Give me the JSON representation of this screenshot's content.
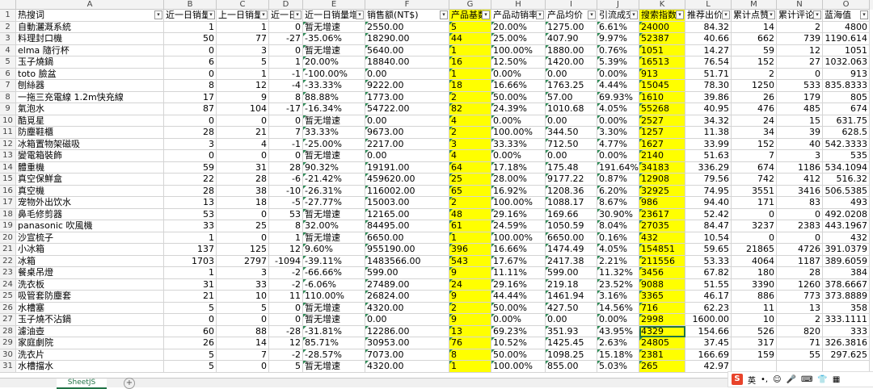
{
  "columns": [
    "A",
    "B",
    "C",
    "D",
    "E",
    "F",
    "G",
    "H",
    "I",
    "J",
    "K",
    "L",
    "M",
    "N",
    "O"
  ],
  "headers": [
    "热搜词",
    "近一日销量",
    "上一日销量",
    "近一日",
    "近一日销量增",
    "销售额(NT$)",
    "产品基数",
    "产品动销率",
    "产品均价",
    "引流成交",
    "搜索指数",
    "推荐出价",
    "累计点赞",
    "累计评论",
    "蓝海值"
  ],
  "rows": [
    [
      "自動灑溉系統",
      "1",
      "1",
      "0",
      "暂无增速",
      "2550.00",
      "5",
      "20.00%",
      "1275.00",
      "6.61%",
      "24000",
      "84.32",
      "14",
      "2",
      "4800"
    ],
    [
      "料理封口機",
      "50",
      "77",
      "-27",
      "-35.06%",
      "18290.00",
      "44",
      "25.00%",
      "407.90",
      "9.97%",
      "52387",
      "40.66",
      "662",
      "739",
      "1190.614"
    ],
    [
      "elma 隨行杯",
      "0",
      "3",
      "0",
      "暂无增速",
      "5640.00",
      "1",
      "100.00%",
      "1880.00",
      "0.76%",
      "1051",
      "14.27",
      "59",
      "12",
      "1051"
    ],
    [
      "玉子燒鍋",
      "6",
      "5",
      "1",
      "20.00%",
      "18840.00",
      "16",
      "12.50%",
      "1420.00",
      "5.39%",
      "16513",
      "76.54",
      "152",
      "27",
      "1032.063"
    ],
    [
      "toto 臉盆",
      "0",
      "1",
      "-1",
      "-100.00%",
      "0.00",
      "1",
      "0.00%",
      "0.00",
      "0.00%",
      "913",
      "51.71",
      "2",
      "0",
      "913"
    ],
    [
      "刨絲器",
      "8",
      "12",
      "-4",
      "-33.33%",
      "9222.00",
      "18",
      "16.66%",
      "1763.25",
      "4.44%",
      "15045",
      "78.30",
      "1250",
      "533",
      "835.8333"
    ],
    [
      "一拖三充電線 1.2m快充線",
      "17",
      "9",
      "8",
      "88.88%",
      "1773.00",
      "2",
      "50.00%",
      "57.00",
      "69.93%",
      "1610",
      "39.86",
      "26",
      "179",
      "805"
    ],
    [
      "氣泡水",
      "87",
      "104",
      "-17",
      "-16.34%",
      "54722.00",
      "82",
      "24.39%",
      "1010.68",
      "4.05%",
      "55268",
      "40.95",
      "476",
      "485",
      "674"
    ],
    [
      "酷覓星",
      "0",
      "0",
      "0",
      "暂无增速",
      "0.00",
      "4",
      "0.00%",
      "0.00",
      "0.00%",
      "2527",
      "34.32",
      "24",
      "15",
      "631.75"
    ],
    [
      "防塵鞋櫃",
      "28",
      "21",
      "7",
      "33.33%",
      "9673.00",
      "2",
      "100.00%",
      "344.50",
      "3.30%",
      "1257",
      "11.38",
      "34",
      "39",
      "628.5"
    ],
    [
      "冰箱置物架磁吸",
      "3",
      "4",
      "-1",
      "-25.00%",
      "2217.00",
      "3",
      "33.33%",
      "712.50",
      "4.77%",
      "1627",
      "33.99",
      "152",
      "40",
      "542.3333"
    ],
    [
      "變電箱裝飾",
      "0",
      "0",
      "0",
      "暂无增速",
      "0.00",
      "4",
      "0.00%",
      "0.00",
      "0.00%",
      "2140",
      "51.63",
      "7",
      "3",
      "535"
    ],
    [
      "體重機",
      "59",
      "31",
      "28",
      "90.32%",
      "19191.00",
      "64",
      "17.18%",
      "175.48",
      "191.64%",
      "34183",
      "336.29",
      "674",
      "1186",
      "534.1094"
    ],
    [
      "真空保鮮盒",
      "22",
      "28",
      "-6",
      "-21.42%",
      "459620.00",
      "25",
      "28.00%",
      "9177.22",
      "0.87%",
      "12908",
      "79.56",
      "742",
      "412",
      "516.32"
    ],
    [
      "真空機",
      "28",
      "38",
      "-10",
      "-26.31%",
      "116002.00",
      "65",
      "16.92%",
      "1208.36",
      "6.20%",
      "32925",
      "74.95",
      "3551",
      "3416",
      "506.5385"
    ],
    [
      "宠物外出饮水",
      "13",
      "18",
      "-5",
      "-27.77%",
      "15003.00",
      "2",
      "100.00%",
      "1088.17",
      "8.67%",
      "986",
      "94.40",
      "171",
      "83",
      "493"
    ],
    [
      "鼻毛修剪器",
      "53",
      "0",
      "53",
      "暂无增速",
      "12165.00",
      "48",
      "29.16%",
      "169.66",
      "30.90%",
      "23617",
      "52.42",
      "0",
      "0",
      "492.0208"
    ],
    [
      "panasonic 吹風機",
      "33",
      "25",
      "8",
      "32.00%",
      "84495.00",
      "61",
      "24.59%",
      "1050.59",
      "8.04%",
      "27035",
      "84.47",
      "3237",
      "2383",
      "443.1967"
    ],
    [
      "沙宣梳子",
      "1",
      "0",
      "1",
      "暂无增速",
      "6650.00",
      "1",
      "100.00%",
      "6650.00",
      "0.16%",
      "432",
      "10.54",
      "0",
      "0",
      "432"
    ],
    [
      "小冰箱",
      "137",
      "125",
      "12",
      "9.60%",
      "955190.00",
      "396",
      "16.66%",
      "1474.49",
      "4.05%",
      "154851",
      "59.65",
      "21865",
      "4726",
      "391.0379"
    ],
    [
      "冰箱",
      "1703",
      "2797",
      "-1094",
      "-39.11%",
      "1483566.00",
      "543",
      "17.67%",
      "2417.38",
      "2.21%",
      "211556",
      "53.33",
      "4064",
      "1187",
      "389.6059"
    ],
    [
      "餐桌吊燈",
      "1",
      "3",
      "-2",
      "-66.66%",
      "599.00",
      "9",
      "11.11%",
      "599.00",
      "11.32%",
      "3456",
      "67.82",
      "180",
      "28",
      "384"
    ],
    [
      "洗衣板",
      "31",
      "33",
      "-2",
      "-6.06%",
      "27489.00",
      "24",
      "29.16%",
      "219.18",
      "23.52%",
      "9088",
      "51.55",
      "3390",
      "1260",
      "378.6667"
    ],
    [
      "吸管套防塵套",
      "21",
      "10",
      "11",
      "110.00%",
      "26824.00",
      "9",
      "44.44%",
      "1461.94",
      "3.16%",
      "3365",
      "46.17",
      "886",
      "773",
      "373.8889"
    ],
    [
      "水槽塞",
      "5",
      "5",
      "0",
      "暂无增速",
      "4320.00",
      "2",
      "50.00%",
      "427.50",
      "14.56%",
      "716",
      "62.23",
      "11",
      "13",
      "358"
    ],
    [
      "玉子燒不沾鍋",
      "0",
      "0",
      "0",
      "暂无增速",
      "0.00",
      "9",
      "0.00%",
      "0.00",
      "0.00%",
      "2998",
      "1600.00",
      "10",
      "2",
      "333.1111"
    ],
    [
      "濾油壺",
      "60",
      "88",
      "-28",
      "-31.81%",
      "12286.00",
      "13",
      "69.23%",
      "351.93",
      "43.95%",
      "4329",
      "154.66",
      "526",
      "820",
      "333"
    ],
    [
      "家庭劇院",
      "26",
      "14",
      "12",
      "85.71%",
      "30953.00",
      "76",
      "10.52%",
      "1425.45",
      "2.63%",
      "24805",
      "37.45",
      "317",
      "71",
      "326.3816"
    ],
    [
      "洗衣片",
      "5",
      "7",
      "-2",
      "-28.57%",
      "7073.00",
      "8",
      "50.00%",
      "1098.25",
      "15.18%",
      "2381",
      "166.69",
      "159",
      "55",
      "297.625"
    ],
    [
      "水槽擋水",
      "5",
      "0",
      "5",
      "暂无增速",
      "4320.00",
      "1",
      "100.00%",
      "855.00",
      "5.03%",
      "265",
      "42.97",
      "",
      "",
      ""
    ]
  ],
  "selected_cell": "K28",
  "highlight_color": "#ffff00",
  "sheet_tab": "SheetJS",
  "add_sheet_symbol": "+",
  "ime": {
    "logo": "S",
    "label": "英"
  }
}
